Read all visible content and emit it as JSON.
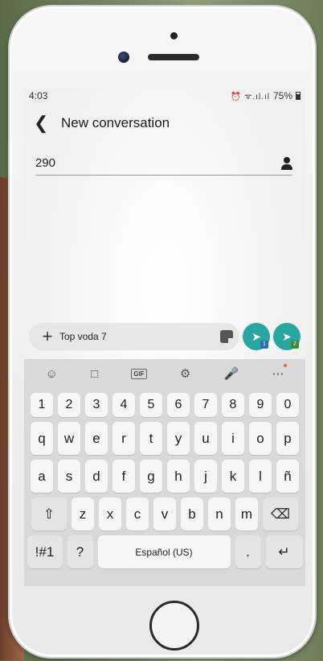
{
  "status_bar": {
    "time": "4:03",
    "icons": "⏰ ᯤ.ıl.ıl",
    "battery": "75%"
  },
  "header": {
    "title": "New conversation",
    "back_icon": "back-arrow-icon"
  },
  "recipient": {
    "value": "290",
    "icon": "person-icon"
  },
  "composer": {
    "text": "Top voda 7",
    "sim1_label": "1",
    "sim2_label": "2"
  },
  "keyboard": {
    "toolbar": [
      "emoji-icon",
      "sticker-icon",
      "gif-icon",
      "settings-icon",
      "mic-icon",
      "more-icon"
    ],
    "gif_label": "GIF",
    "row_numbers": [
      "1",
      "2",
      "3",
      "4",
      "5",
      "6",
      "7",
      "8",
      "9",
      "0"
    ],
    "row1": [
      "q",
      "w",
      "e",
      "r",
      "t",
      "y",
      "u",
      "i",
      "o",
      "p"
    ],
    "row2": [
      "a",
      "s",
      "d",
      "f",
      "g",
      "h",
      "j",
      "k",
      "l",
      "ñ"
    ],
    "row3": [
      "z",
      "x",
      "c",
      "v",
      "b",
      "n",
      "m"
    ],
    "symbols_label": "!#1",
    "question_label": "?",
    "space_label": "Español (US)",
    "period_label": "."
  }
}
